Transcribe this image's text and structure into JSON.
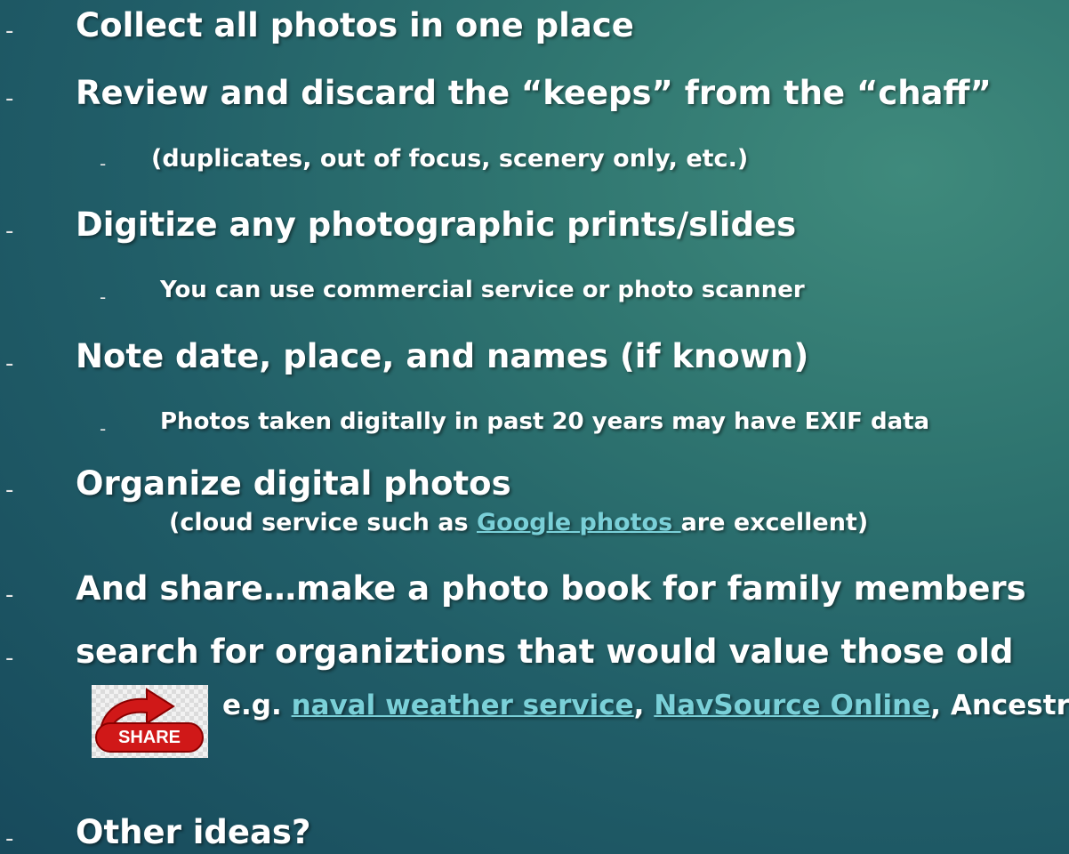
{
  "bullets": {
    "b1": "Collect all photos in one place",
    "b2": "Review and discard the “keeps” from the “chaff”",
    "b2_sub": "(duplicates, out of focus, scenery only, etc.)",
    "b3": "Digitize any photographic prints/slides",
    "b3_sub": "You can use commercial service or photo scanner",
    "b4": "Note date, place, and names (if known)",
    "b4_sub": "Photos taken digitally in past 20 years may have EXIF data",
    "b5": "Organize digital photos",
    "b5_note_pre": "(cloud service such as ",
    "b5_note_link": "Google photos ",
    "b5_note_post": " are excellent)",
    "b6": "And share…make a photo book for family members",
    "b7": "search for organiztions that would value those old",
    "b7_pre": "e.g. ",
    "b7_link1": "naval weather service",
    "b7_sep": ", ",
    "b7_link2": "NavSource Online",
    "b7_post": ", Ancestr",
    "b8": "Other ideas?"
  },
  "share_image": {
    "label": "SHARE",
    "arrow_color": "#d01818"
  },
  "colors": {
    "link": "#7ad0d8",
    "text": "#ffffff"
  },
  "dash_glyph": "-"
}
